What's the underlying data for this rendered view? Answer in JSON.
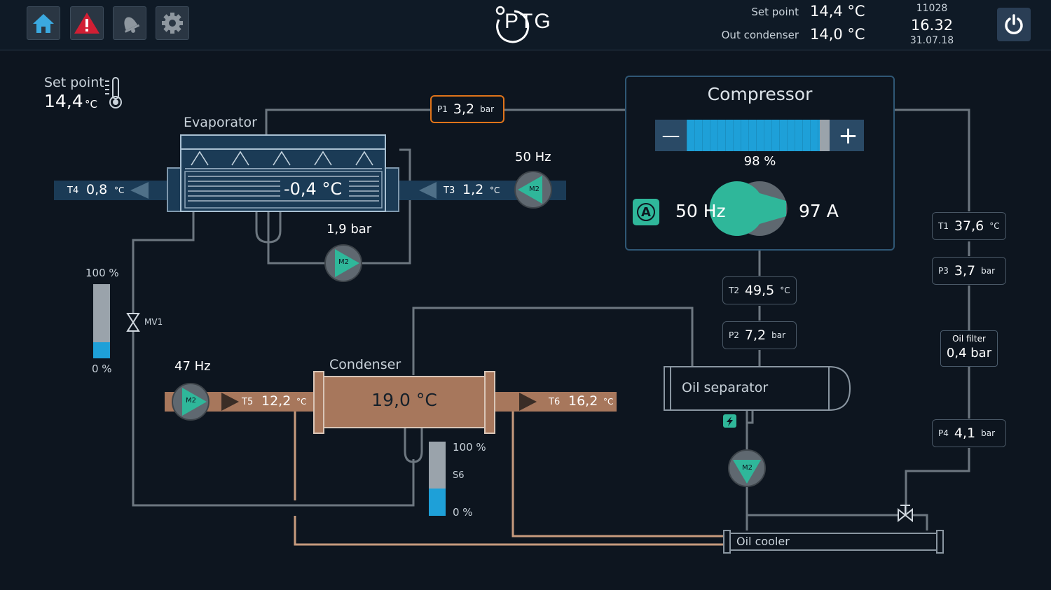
{
  "header": {
    "logo": "PTG",
    "setpoint_label": "Set point",
    "setpoint_value": "14,4 °C",
    "outcond_label": "Out condenser",
    "outcond_value": "14,0 °C",
    "id": "11028",
    "time": "16.32",
    "date": "31.07.18",
    "icons": [
      "home-icon",
      "alarm-warning-icon",
      "bell-icon",
      "gear-icon",
      "power-icon"
    ]
  },
  "setpoint_panel": {
    "label": "Set point",
    "value": "14,4",
    "unit": "°C"
  },
  "evaporator": {
    "label": "Evaporator",
    "temp": "-0,4 °C",
    "pump_pressure": "1,9 bar",
    "pump_tag": "M2"
  },
  "flows": {
    "t4": {
      "tag": "T4",
      "value": "0,8",
      "unit": "°C"
    },
    "t3": {
      "tag": "T3",
      "value": "1,2",
      "unit": "°C"
    },
    "t3_pump_freq": "50 Hz",
    "t3_pump_tag": "M2",
    "t5": {
      "tag": "T5",
      "value": "12,2",
      "unit": "°C"
    },
    "t6": {
      "tag": "T6",
      "value": "16,2",
      "unit": "°C"
    },
    "cond_pump_freq": "47 Hz",
    "cond_pump_tag": "M2"
  },
  "p1": {
    "tag": "P1",
    "value": "3,2",
    "unit": "bar"
  },
  "compressor": {
    "title": "Compressor",
    "minus_label": "—",
    "plus_label": "+",
    "percent": "98 %",
    "level": 0.98,
    "auto_icon": "A",
    "freq": "50 Hz",
    "current": "97 A"
  },
  "right_sensors": {
    "t1": {
      "tag": "T1",
      "value": "37,6",
      "unit": "°C"
    },
    "p3": {
      "tag": "P3",
      "value": "3,7",
      "unit": "bar"
    },
    "oil_filter_label": "Oil filter",
    "oil_filter_value": "0,4 bar",
    "p4": {
      "tag": "P4",
      "value": "4,1",
      "unit": "bar"
    }
  },
  "mid_sensors": {
    "t2": {
      "tag": "T2",
      "value": "49,5",
      "unit": "°C"
    },
    "p2": {
      "tag": "P2",
      "value": "7,2",
      "unit": "bar"
    }
  },
  "level_gauge": {
    "max": "100 %",
    "min": "0 %",
    "level": 0.22
  },
  "valve_mv1": "MV1",
  "condenser": {
    "label": "Condenser",
    "temp": "19,0 °C"
  },
  "s6_gauge": {
    "max": "100 %",
    "tag": "S6",
    "min": "0 %",
    "level": 0.37
  },
  "oil_separator": {
    "label": "Oil separator",
    "pump_tag": "M2"
  },
  "oil_cooler": {
    "label": "Oil cooler"
  },
  "colors": {
    "accent": "#2fb79a",
    "bar_blue": "#1ea0d8",
    "orange": "#e0741a",
    "condenser": "#a7775c",
    "water_in": "#1b3b56"
  }
}
